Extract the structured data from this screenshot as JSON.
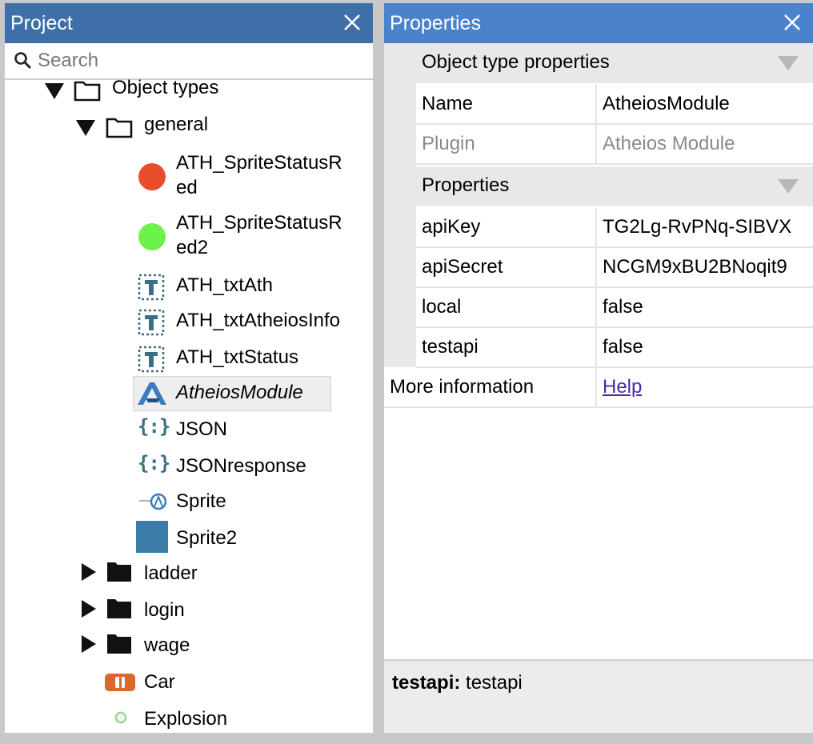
{
  "project": {
    "title": "Project",
    "search_placeholder": "Search",
    "tree": {
      "object_types": "Object types",
      "general": "general",
      "items": [
        {
          "label": "ATH_SpriteStatusR\ned",
          "icon": "red-circle-icon"
        },
        {
          "label": "ATH_SpriteStatusR\ned2",
          "icon": "green-circle-icon"
        },
        {
          "label": "ATH_txtAth",
          "icon": "text-object-icon"
        },
        {
          "label": "ATH_txtAtheiosInfo",
          "icon": "text-object-icon"
        },
        {
          "label": "ATH_txtStatus",
          "icon": "text-object-icon"
        },
        {
          "label": "AtheiosModule",
          "icon": "atheios-icon"
        },
        {
          "label": "JSON",
          "icon": "json-icon"
        },
        {
          "label": "JSONresponse",
          "icon": "json-icon"
        },
        {
          "label": "Sprite",
          "icon": "sprite-atheios-icon"
        },
        {
          "label": "Sprite2",
          "icon": "sprite-square-icon"
        }
      ],
      "folders": [
        "ladder",
        "login",
        "wage"
      ],
      "others": [
        {
          "label": "Car",
          "icon": "car-icon"
        },
        {
          "label": "Explosion",
          "icon": "explosion-icon"
        }
      ]
    }
  },
  "properties": {
    "title": "Properties",
    "section_object_type": "Object type properties",
    "name_key": "Name",
    "name_value": "AtheiosModule",
    "plugin_key": "Plugin",
    "plugin_value": "Atheios Module",
    "section_properties": "Properties",
    "rows": [
      {
        "key": "apiKey",
        "value": "TG2Lg-RvPNq-SIBVX"
      },
      {
        "key": "apiSecret",
        "value": "NCGM9xBU2BNoqit9"
      },
      {
        "key": "local",
        "value": "false"
      },
      {
        "key": "testapi",
        "value": "false"
      }
    ],
    "more_info_key": "More information",
    "more_info_link": "Help",
    "footer_bold": "testapi:",
    "footer_text": "testapi"
  },
  "colors": {
    "project_titlebar": "#3f6fa8",
    "properties_titlebar": "#4a83cc",
    "red_dot": "#e84e2c",
    "green_dot": "#6cf24b",
    "teal_icon": "#3a6f86"
  }
}
